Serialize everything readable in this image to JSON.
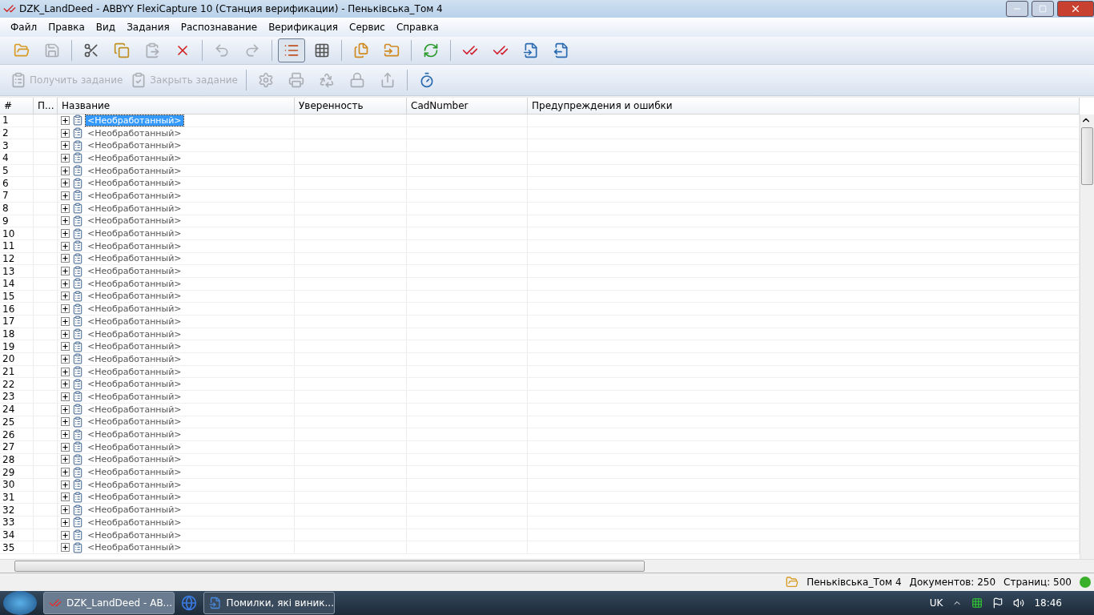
{
  "window": {
    "title": "DZK_LandDeed - ABBYY FlexiCapture 10 (Станция верификации) - Пеньківська_Том 4"
  },
  "menu": [
    "Файл",
    "Правка",
    "Вид",
    "Задания",
    "Распознавание",
    "Верификация",
    "Сервис",
    "Справка"
  ],
  "toolbar": [
    {
      "kind": "open",
      "disabled": false,
      "selected": false
    },
    {
      "kind": "save",
      "disabled": true,
      "selected": false
    },
    {
      "kind": "sep"
    },
    {
      "kind": "cut",
      "disabled": false,
      "selected": false
    },
    {
      "kind": "copy",
      "disabled": false,
      "selected": false
    },
    {
      "kind": "paste",
      "disabled": true,
      "selected": false
    },
    {
      "kind": "delete",
      "disabled": false,
      "selected": false
    },
    {
      "kind": "sep"
    },
    {
      "kind": "undo",
      "disabled": true,
      "selected": false
    },
    {
      "kind": "redo",
      "disabled": true,
      "selected": false
    },
    {
      "kind": "sep"
    },
    {
      "kind": "list",
      "disabled": false,
      "selected": true
    },
    {
      "kind": "grid",
      "disabled": false,
      "selected": false
    },
    {
      "kind": "sep"
    },
    {
      "kind": "docs",
      "disabled": false,
      "selected": false
    },
    {
      "kind": "folder",
      "disabled": false,
      "selected": false
    },
    {
      "kind": "sep"
    },
    {
      "kind": "refresh",
      "disabled": false,
      "selected": false
    },
    {
      "kind": "sep"
    },
    {
      "kind": "check-back",
      "disabled": false,
      "selected": false
    },
    {
      "kind": "check-next",
      "disabled": false,
      "selected": false
    },
    {
      "kind": "doc-back",
      "disabled": false,
      "selected": false
    },
    {
      "kind": "doc-next",
      "disabled": false,
      "selected": false
    }
  ],
  "task_toolbar": [
    {
      "kind": "get",
      "label": "Получить задание",
      "disabled": true
    },
    {
      "kind": "close",
      "label": "Закрыть задание",
      "disabled": true
    },
    {
      "kind": "sep"
    },
    {
      "kind": "settings",
      "disabled": true
    },
    {
      "kind": "scan",
      "disabled": true
    },
    {
      "kind": "recycle",
      "disabled": true
    },
    {
      "kind": "lock",
      "disabled": true
    },
    {
      "kind": "export",
      "disabled": true
    },
    {
      "kind": "sep"
    },
    {
      "kind": "timer",
      "disabled": false
    }
  ],
  "table": {
    "columns": [
      "#",
      "П...",
      "Название",
      "Уверенность",
      "CadNumber",
      "Предупреждения и ошибки"
    ],
    "rows": [
      {
        "number": "1",
        "name": "<Необработанный>",
        "selected": true
      },
      {
        "number": "2",
        "name": "<Необработанный>",
        "selected": false
      },
      {
        "number": "3",
        "name": "<Необработанный>",
        "selected": false
      },
      {
        "number": "4",
        "name": "<Необработанный>",
        "selected": false
      },
      {
        "number": "5",
        "name": "<Необработанный>",
        "selected": false
      },
      {
        "number": "6",
        "name": "<Необработанный>",
        "selected": false
      },
      {
        "number": "7",
        "name": "<Необработанный>",
        "selected": false
      },
      {
        "number": "8",
        "name": "<Необработанный>",
        "selected": false
      },
      {
        "number": "9",
        "name": "<Необработанный>",
        "selected": false
      },
      {
        "number": "10",
        "name": "<Необработанный>",
        "selected": false
      },
      {
        "number": "11",
        "name": "<Необработанный>",
        "selected": false
      },
      {
        "number": "12",
        "name": "<Необработанный>",
        "selected": false
      },
      {
        "number": "13",
        "name": "<Необработанный>",
        "selected": false
      },
      {
        "number": "14",
        "name": "<Необработанный>",
        "selected": false
      },
      {
        "number": "15",
        "name": "<Необработанный>",
        "selected": false
      },
      {
        "number": "16",
        "name": "<Необработанный>",
        "selected": false
      },
      {
        "number": "17",
        "name": "<Необработанный>",
        "selected": false
      },
      {
        "number": "18",
        "name": "<Необработанный>",
        "selected": false
      },
      {
        "number": "19",
        "name": "<Необработанный>",
        "selected": false
      },
      {
        "number": "20",
        "name": "<Необработанный>",
        "selected": false
      },
      {
        "number": "21",
        "name": "<Необработанный>",
        "selected": false
      },
      {
        "number": "22",
        "name": "<Необработанный>",
        "selected": false
      },
      {
        "number": "23",
        "name": "<Необработанный>",
        "selected": false
      },
      {
        "number": "24",
        "name": "<Необработанный>",
        "selected": false
      },
      {
        "number": "25",
        "name": "<Необработанный>",
        "selected": false
      },
      {
        "number": "26",
        "name": "<Необработанный>",
        "selected": false
      },
      {
        "number": "27",
        "name": "<Необработанный>",
        "selected": false
      },
      {
        "number": "28",
        "name": "<Необработанный>",
        "selected": false
      },
      {
        "number": "29",
        "name": "<Необработанный>",
        "selected": false
      },
      {
        "number": "30",
        "name": "<Необработанный>",
        "selected": false
      },
      {
        "number": "31",
        "name": "<Необработанный>",
        "selected": false
      },
      {
        "number": "32",
        "name": "<Необработанный>",
        "selected": false
      },
      {
        "number": "33",
        "name": "<Необработанный>",
        "selected": false
      },
      {
        "number": "34",
        "name": "<Необработанный>",
        "selected": false
      },
      {
        "number": "35",
        "name": "<Необработанный>",
        "selected": false
      }
    ]
  },
  "status_bar": {
    "batch": "Пеньківська_Том 4",
    "documents": "Документов: 250",
    "pages": "Страниц: 500",
    "connected": true
  },
  "taskbar": {
    "items": [
      {
        "kind": "app",
        "label": "DZK_LandDeed - AB...",
        "selected": true
      },
      {
        "kind": "globe"
      },
      {
        "kind": "word",
        "label": "Помилки, які виник...",
        "selected": false
      }
    ],
    "language": "UK",
    "clock": "18:46"
  }
}
